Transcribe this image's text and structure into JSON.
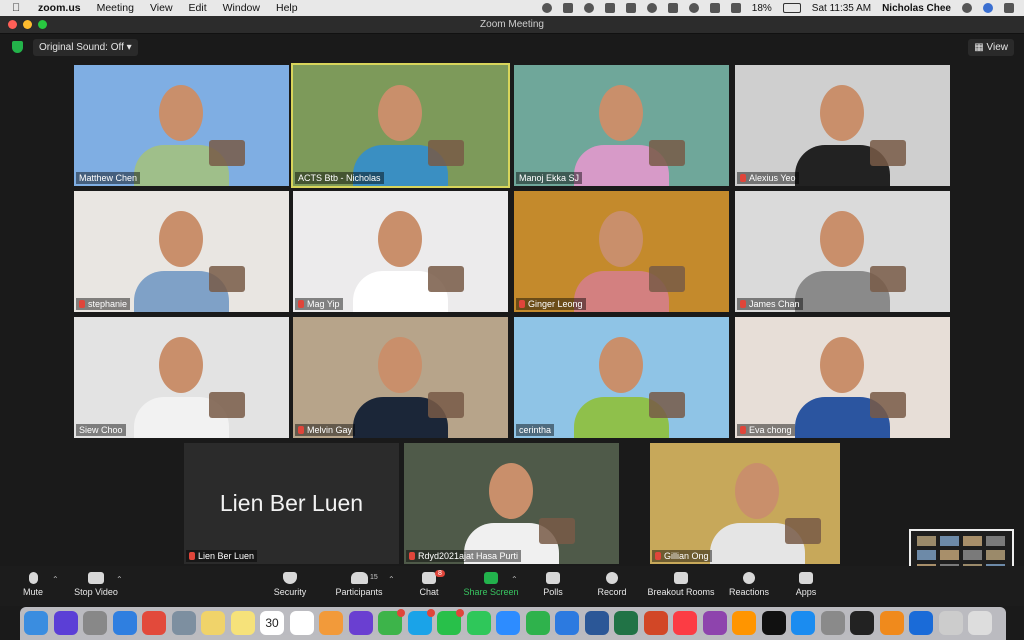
{
  "menubar": {
    "app": "zoom.us",
    "menus": [
      "Meeting",
      "View",
      "Edit",
      "Window",
      "Help"
    ],
    "battery": "18%",
    "datetime": "Sat 11:35 AM",
    "user": "Nicholas Chee"
  },
  "window": {
    "title": "Zoom Meeting"
  },
  "topbar": {
    "original_sound": "Original Sound: Off",
    "view": "View"
  },
  "participants": [
    {
      "name": "Matthew Chen",
      "muted": false,
      "bg": "#7faee3",
      "active": false
    },
    {
      "name": "ACTS Btb - Nicholas",
      "muted": false,
      "bg": "#7d9a5a",
      "active": true
    },
    {
      "name": "Manoj Ekka SJ",
      "muted": false,
      "bg": "#6fa79a",
      "active": false
    },
    {
      "name": "Alexius Yeo",
      "muted": true,
      "bg": "#cfcfcf",
      "active": false
    },
    {
      "name": "stephanie",
      "muted": true,
      "bg": "#e9e6e2",
      "active": false
    },
    {
      "name": "Mag Yip",
      "muted": true,
      "bg": "#ecebec",
      "active": false
    },
    {
      "name": "Ginger Leong",
      "muted": true,
      "bg": "#c48a2c",
      "active": false
    },
    {
      "name": "James Chan",
      "muted": true,
      "bg": "#dadada",
      "active": false
    },
    {
      "name": "Siew Choo",
      "muted": false,
      "bg": "#e3e3e3",
      "active": false
    },
    {
      "name": "Melvin Gay",
      "muted": true,
      "bg": "#b7a48a",
      "active": false
    },
    {
      "name": "cerintha",
      "muted": false,
      "bg": "#8fc4e6",
      "active": false
    },
    {
      "name": "Eva chong",
      "muted": true,
      "bg": "#e7ded7",
      "active": false
    },
    {
      "name": "Lien Ber Luen",
      "muted": true,
      "bg": "#2b2b2b",
      "active": false,
      "video_off": true
    },
    {
      "name": "Rdyd2021ajat Hasa Purti",
      "muted": true,
      "bg": "#4f5a49",
      "active": false
    },
    {
      "name": "Gillian Ong",
      "muted": true,
      "bg": "#c7a85a",
      "active": false
    }
  ],
  "toolbar": {
    "mute": "Mute",
    "stop_video": "Stop Video",
    "security": "Security",
    "participants": "Participants",
    "participants_count": "15",
    "chat": "Chat",
    "chat_badge": "8",
    "share_screen": "Share Screen",
    "polls": "Polls",
    "record": "Record",
    "breakout": "Breakout Rooms",
    "reactions": "Reactions",
    "apps": "Apps"
  },
  "dock": {
    "calendar_date": "30",
    "icons": [
      "finder-icon",
      "siri-icon",
      "launchpad-icon",
      "safari-icon",
      "chrome-icon",
      "preview-icon",
      "notes-icon",
      "stickies-icon",
      "calendar-icon",
      "reminders-icon",
      "photos-icon",
      "imovie-icon",
      "messages-icon",
      "skype-icon",
      "whatsapp-icon",
      "facetime-icon",
      "zoom-icon",
      "numbers-icon",
      "keynote-icon",
      "word-icon",
      "excel-icon",
      "powerpoint-icon",
      "music-icon",
      "podcasts-icon",
      "books-icon",
      "appletv-icon",
      "appstore-icon",
      "settings-icon",
      "terminal-icon",
      "vlc-icon",
      "quicktime-icon",
      "preview2-icon",
      "trash-icon"
    ]
  }
}
